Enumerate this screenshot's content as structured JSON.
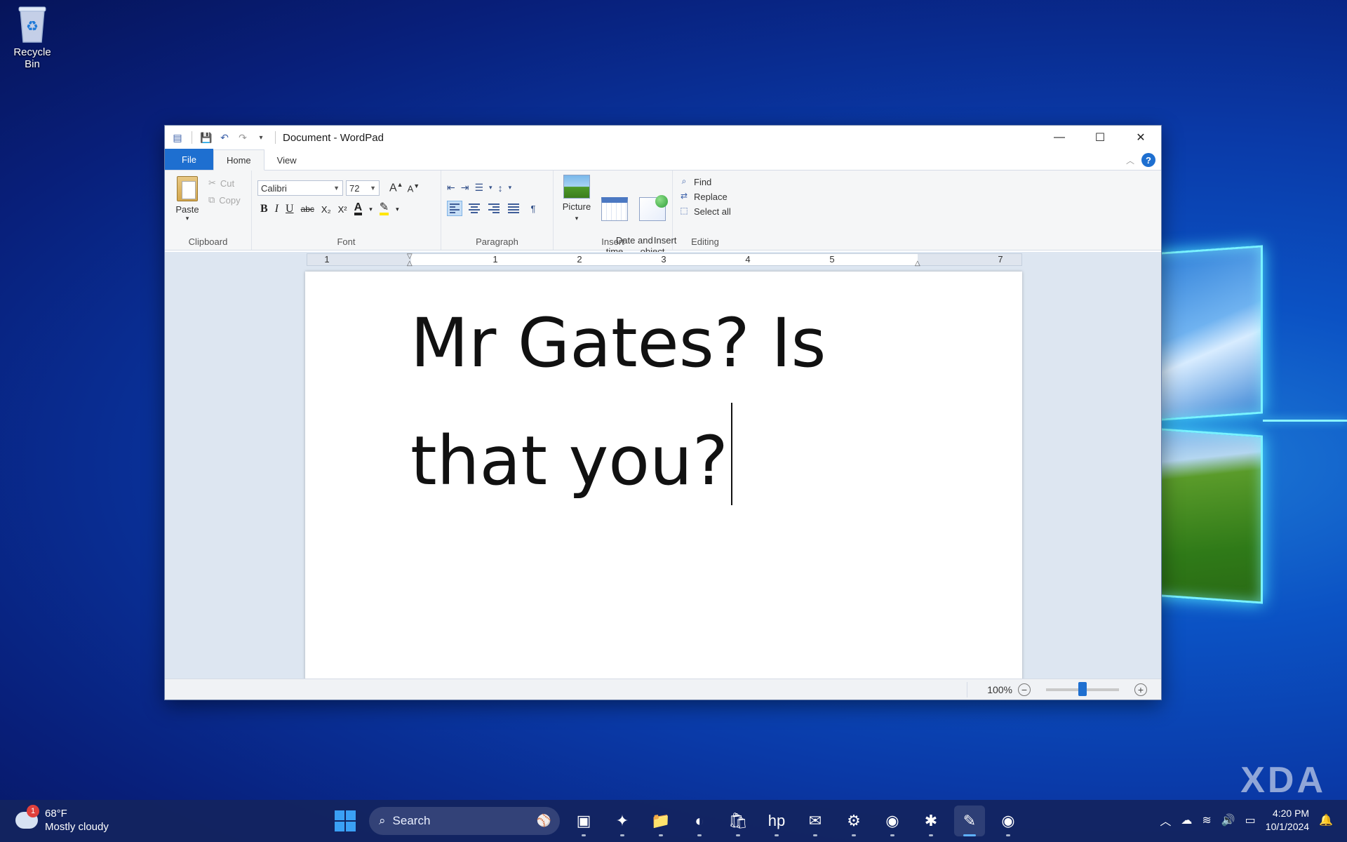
{
  "desktop": {
    "recycle_bin_label": "Recycle Bin",
    "watermark": "XDA"
  },
  "window": {
    "title": "Document - WordPad",
    "controls": {
      "minimize": "—",
      "maximize": "☐",
      "close": "✕"
    },
    "tabs": {
      "file": "File",
      "home": "Home",
      "view": "View"
    },
    "help": "?"
  },
  "ribbon": {
    "clipboard": {
      "label": "Clipboard",
      "paste": "Paste",
      "cut": "Cut",
      "copy": "Copy"
    },
    "font": {
      "label": "Font",
      "family": "Calibri",
      "size": "72",
      "bold": "B",
      "italic": "I",
      "underline": "U",
      "strikethrough": "abc",
      "subscript": "X₂",
      "superscript": "X²",
      "font_color": "A",
      "grow": "A",
      "shrink": "A"
    },
    "paragraph": {
      "label": "Paragraph"
    },
    "insert": {
      "label": "Insert",
      "picture": "Picture",
      "date_time": "Date and\ntime",
      "insert_object": "Insert\nobject"
    },
    "editing": {
      "label": "Editing",
      "find": "Find",
      "replace": "Replace",
      "select_all": "Select all"
    }
  },
  "ruler": {
    "numbers": [
      "1",
      "1",
      "2",
      "3",
      "4",
      "5",
      "7"
    ]
  },
  "document": {
    "text": "Mr Gates? Is\nthat you?"
  },
  "statusbar": {
    "zoom": "100%",
    "zoom_value": 100
  },
  "taskbar": {
    "weather": {
      "temp": "68°F",
      "condition": "Mostly cloudy",
      "badge": "1"
    },
    "search_placeholder": "Search",
    "apps": [
      {
        "name": "task-view",
        "glyph": "▣"
      },
      {
        "name": "copilot",
        "glyph": "✦"
      },
      {
        "name": "file-explorer",
        "glyph": "📁"
      },
      {
        "name": "edge",
        "glyph": "◐"
      },
      {
        "name": "microsoft-store",
        "glyph": "🛍"
      },
      {
        "name": "myhp",
        "glyph": "hp"
      },
      {
        "name": "outlook",
        "glyph": "✉"
      },
      {
        "name": "steam",
        "glyph": "⚙"
      },
      {
        "name": "chrome",
        "glyph": "◉"
      },
      {
        "name": "slack",
        "glyph": "✱"
      },
      {
        "name": "wordpad",
        "glyph": "✎"
      },
      {
        "name": "chrome-2",
        "glyph": "◉"
      }
    ],
    "time": "4:20 PM",
    "date": "10/1/2024"
  },
  "colors": {
    "accent": "#1e6fd0",
    "desktop": "#0a3aa8"
  }
}
